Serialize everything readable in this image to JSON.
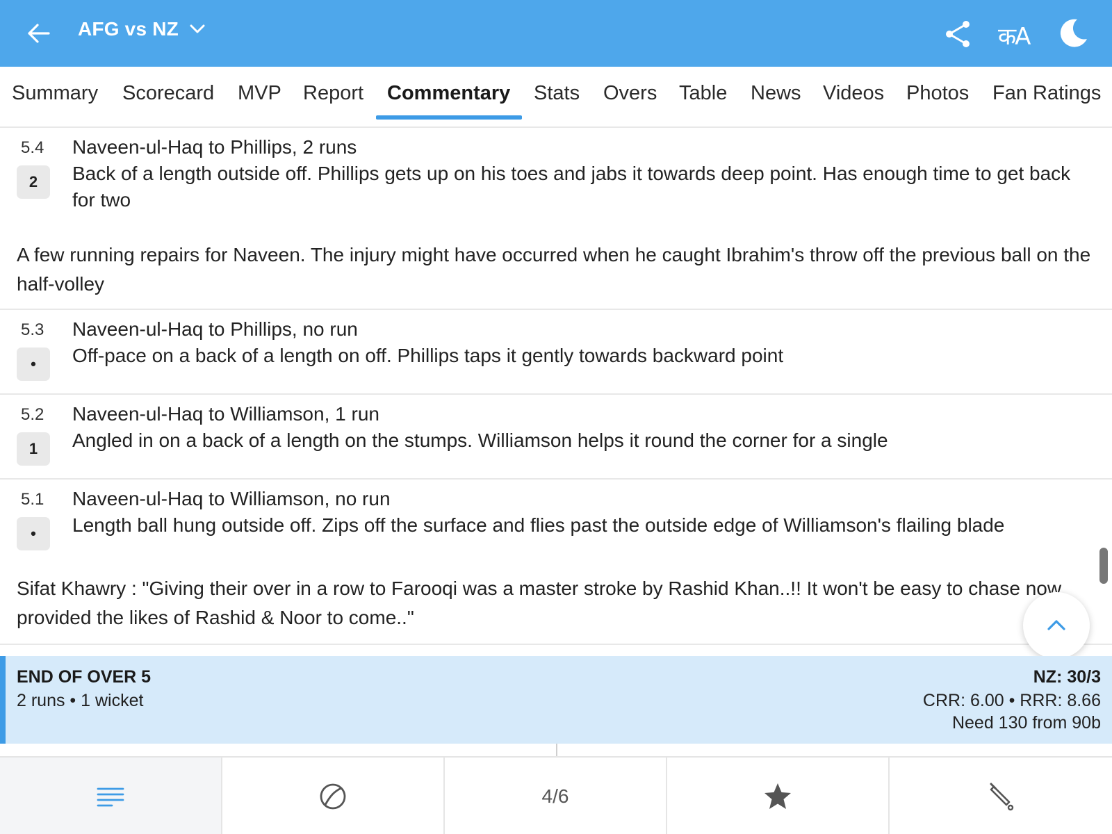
{
  "header": {
    "title": "AFG vs NZ",
    "lang_label": "कA"
  },
  "tabs": [
    {
      "label": "Summary"
    },
    {
      "label": "Scorecard"
    },
    {
      "label": "MVP"
    },
    {
      "label": "Report"
    },
    {
      "label": "Commentary",
      "active": true
    },
    {
      "label": "Stats"
    },
    {
      "label": "Overs"
    },
    {
      "label": "Table"
    },
    {
      "label": "News"
    },
    {
      "label": "Videos"
    },
    {
      "label": "Photos"
    },
    {
      "label": "Fan Ratings"
    }
  ],
  "feed": {
    "balls": [
      {
        "over": "5.4",
        "result": "2",
        "title": "Naveen-ul-Haq to Phillips, 2 runs",
        "text": "Back of a length outside off. Phillips gets up on his toes and jabs it towards deep point. Has enough time to get back for two"
      },
      {
        "over": "5.3",
        "result": "•",
        "title": "Naveen-ul-Haq to Phillips, no run",
        "text": "Off-pace on a back of a length on off. Phillips taps it gently towards backward point"
      },
      {
        "over": "5.2",
        "result": "1",
        "title": "Naveen-ul-Haq to Williamson, 1 run",
        "text": "Angled in on a back of a length on the stumps. Williamson helps it round the corner for a single"
      },
      {
        "over": "5.1",
        "result": "•",
        "title": "Naveen-ul-Haq to Williamson, no run",
        "text": "Length ball hung outside off. Zips off the surface and flies past the outside edge of Williamson's flailing blade"
      }
    ],
    "notes": [
      "A few running repairs for Naveen. The injury might have occurred when he caught Ibrahim's throw off the previous ball on the half-volley",
      "Sifat Khawry : \"Giving their over in a row to Farooqi was a master stroke by Rashid Khan..!! It won't be easy to chase now provided the likes of Rashid & Noor to come..\""
    ]
  },
  "end_of_over": {
    "title": "END OF OVER 5",
    "summary": "2 runs • 1 wicket",
    "score": "NZ: 30/3",
    "rates": "CRR: 6.00 • RRR: 8.66",
    "need": "Need 130 from 90b"
  },
  "bottom_bar": {
    "page_indicator": "4/6"
  },
  "colors": {
    "header_bg": "#4ea7eb",
    "accent": "#3d9be6",
    "eoo_bg": "#d6eafa"
  }
}
